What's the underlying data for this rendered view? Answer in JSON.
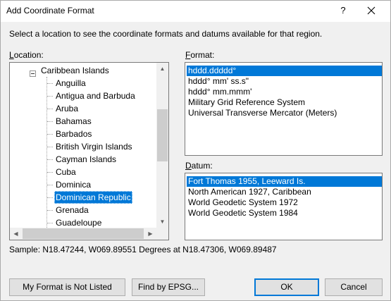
{
  "window": {
    "title": "Add Coordinate Format",
    "help_label": "?"
  },
  "instruction": "Select a location to see the coordinate formats and datums available for that region.",
  "location": {
    "label_underlined": "L",
    "label_rest": "ocation:",
    "root": "Caribbean Islands",
    "items": [
      "Anguilla",
      "Antigua and Barbuda",
      "Aruba",
      "Bahamas",
      "Barbados",
      "British Virgin Islands",
      "Cayman Islands",
      "Cuba",
      "Dominica",
      "Dominican Republic",
      "Grenada",
      "Guadeloupe"
    ],
    "selected": "Dominican Republic"
  },
  "format": {
    "label_underlined": "F",
    "label_rest": "ormat:",
    "items": [
      "hddd.ddddd°",
      "hddd° mm' ss.s\"",
      "hddd° mm.mmm'",
      "Military Grid Reference System",
      "Universal Transverse Mercator (Meters)"
    ],
    "selected": "hddd.ddddd°"
  },
  "datum": {
    "label_underlined": "D",
    "label_rest": "atum:",
    "items": [
      "Fort Thomas 1955, Leeward Is.",
      "North American 1927, Caribbean",
      "World Geodetic System 1972",
      "World Geodetic System 1984"
    ],
    "selected": "Fort Thomas 1955, Leeward Is."
  },
  "sample": "Sample: N18.47244, W069.89551 Degrees at N18.47306, W069.89487",
  "buttons": {
    "not_listed": "My Format is Not Listed",
    "epsg": "Find by EPSG...",
    "ok": "OK",
    "cancel": "Cancel"
  },
  "colors": {
    "selection": "#0078d7",
    "dialog_bg": "#f0f0f0"
  }
}
